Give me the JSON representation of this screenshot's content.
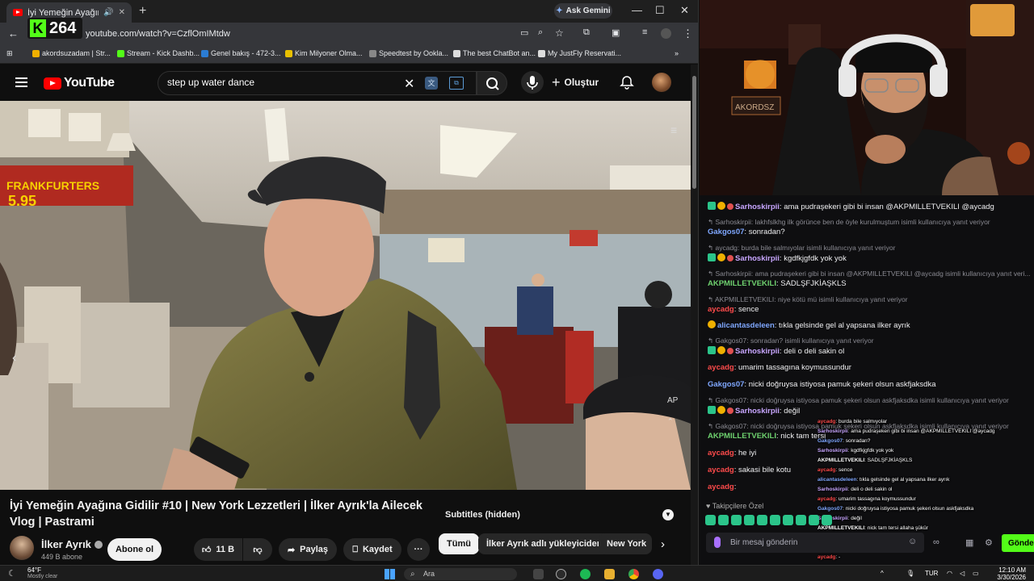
{
  "browser": {
    "tab_title": "İyi Yemeğin Ayağına Gidili",
    "ask_gemini": "Ask Gemini",
    "url": "youtube.com/watch?v=CzflOmIMtdw",
    "kick_viewers": "264",
    "bookmarks": [
      {
        "label": "akordsuzadam | Str...",
        "color": "#f0b000"
      },
      {
        "label": "Stream - Kick Dashb...",
        "color": "#53fc18"
      },
      {
        "label": "Genel bakış - 472-3...",
        "color": "#2b7cd3"
      },
      {
        "label": "Kim Milyoner Olma...",
        "color": "#e8c000"
      },
      {
        "label": "Speedtest by Ookla...",
        "color": "#888888"
      },
      {
        "label": "The best ChatBot an...",
        "color": "#dddddd"
      },
      {
        "label": "My JustFly Reservati...",
        "color": "#dddddd"
      }
    ]
  },
  "youtube": {
    "logo_text": "YouTube",
    "search_value": "step up water dance",
    "create_label": "Oluştur",
    "video_title": "İyi Yemeğin Ayağına Gidilir #10 | New York Lezzetleri | İlker Ayrık'la Ailecek Vlog | Pastrami",
    "channel_name": "İlker Ayrık",
    "channel_subs": "449 B abone",
    "subscribe_label": "Abone ol",
    "like_count": "11 B",
    "share_label": "Paylaş",
    "save_label": "Kaydet",
    "subtitles_label": "Subtitles (hidden)",
    "chips": [
      "Tümü",
      "İlker Ayrık adlı yükleyiciden",
      "New York"
    ],
    "video_overlay_text": "AP"
  },
  "chat": {
    "messages": [
      {
        "type": "msg",
        "user": "Sarhoskirpii",
        "ucls": "u-purple",
        "badges": "gyr",
        "text": ": ama pudraşekeri gibi bi insan @AKPMILLETVEKILI @aycadg"
      },
      {
        "type": "reply",
        "text": "Sarhoskirpii: lakhfslkhg ilk görünce ben de öyle kurulmuştum isimli kullanıcıya yanıt veriyor"
      },
      {
        "type": "msg",
        "user": "Gakgos07",
        "ucls": "u-blue",
        "badges": "",
        "text": ": sonradan?"
      },
      {
        "type": "reply",
        "text": "aycadg: burda bile salmıyolar isimli kullanıcıya yanıt veriyor"
      },
      {
        "type": "msg",
        "user": "Sarhoskirpii",
        "ucls": "u-purple",
        "badges": "gyr",
        "text": ": kgdfkjgfdk yok yok"
      },
      {
        "type": "reply",
        "text": "Sarhoskirpii: ama pudraşekeri gibi bi insan @AKPMILLETVEKILI @aycadg isimli kullanıcıya yanıt veri..."
      },
      {
        "type": "msg",
        "user": "AKPMILLETVEKILI",
        "ucls": "u-green",
        "badges": "",
        "text": ": SADLŞFJKİAŞKLS"
      },
      {
        "type": "reply",
        "text": "AKPMILLETVEKILI: niye kötü mü isimli kullanıcıya yanıt veriyor"
      },
      {
        "type": "msg",
        "user": "aycadg",
        "ucls": "u-red",
        "badges": "",
        "text": ": sence"
      },
      {
        "type": "msg",
        "user": "alicantasdeleen",
        "ucls": "u-blue",
        "badges": "y",
        "text": ": tıkla gelsinde gel al yapsana ilker ayrık"
      },
      {
        "type": "reply",
        "text": "Gakgos07: sonradan? isimli kullanıcıya yanıt veriyor"
      },
      {
        "type": "msg",
        "user": "Sarhoskirpii",
        "ucls": "u-purple",
        "badges": "gyr",
        "text": ": deli o deli sakin ol"
      },
      {
        "type": "msg",
        "user": "aycadg",
        "ucls": "u-red",
        "badges": "",
        "text": ": umarim tassagına koymussundur"
      },
      {
        "type": "msg",
        "user": "Gakgos07",
        "ucls": "u-blue",
        "badges": "",
        "text": ": nicki doğruysa istiyosa pamuk şekeri olsun askfjaksdka"
      },
      {
        "type": "reply",
        "text": "Gakgos07: nicki doğruysa istiyosa pamuk şekeri olsun askfjaksdka isimli kullanıcıya yanıt veriyor"
      },
      {
        "type": "msg",
        "user": "Sarhoskirpii",
        "ucls": "u-purple",
        "badges": "gyr",
        "text": ": değil"
      },
      {
        "type": "reply",
        "text": "Gakgos07: nicki doğruysa istiyosa pamuk şekeri olsun askfjaksdka isimli kullanıcıya yanıt veriyor"
      },
      {
        "type": "msg",
        "user": "AKPMILLETVEKILI",
        "ucls": "u-green",
        "badges": "",
        "text": ": nick tam tersi"
      },
      {
        "type": "msg",
        "user": "aycadg",
        "ucls": "u-red",
        "badges": "",
        "text": ": he iyi"
      },
      {
        "type": "msg",
        "user": "aycadg",
        "ucls": "u-red",
        "badges": "",
        "text": ": sakasi bile kotu"
      },
      {
        "type": "msg",
        "user": "aycadg",
        "ucls": "u-red",
        "badges": "",
        "text": ":"
      }
    ],
    "overlay": [
      {
        "user": "aycadg",
        "ucls": "u-red",
        "text": ": burda bile salmıyolar"
      },
      {
        "user": "Sarhoskirpii",
        "ucls": "u-purple",
        "text": ": ama pudraşekeri gibi bi insan @AKPMILLETVEKILI @aycadg"
      },
      {
        "user": "Gakgos07",
        "ucls": "u-blue",
        "text": ": sonradan?"
      },
      {
        "user": "Sarhoskirpii",
        "ucls": "u-purple",
        "text": ": kgdfkjgfdk yok yok"
      },
      {
        "user": "AKPMILLETVEKILI",
        "ucls": "u-white",
        "text": ": SADLŞFJKİAŞKLS"
      },
      {
        "user": "aycadg",
        "ucls": "u-red",
        "text": ": sence"
      },
      {
        "user": "alicantasdeleen",
        "ucls": "u-blue",
        "text": ": tıkla gelsinde gel al yapsana ilker ayrık"
      },
      {
        "user": "Sarhoskirpii",
        "ucls": "u-purple",
        "text": ": deli o deli sakin ol"
      },
      {
        "user": "aycadg",
        "ucls": "u-red",
        "text": ": umarim tassagına koymussundur"
      },
      {
        "user": "Gakgos07",
        "ucls": "u-blue",
        "text": ": nicki doğruysa istiyosa pamuk şekeri olsun askfjaksdka"
      },
      {
        "user": "Sarhoskirpii",
        "ucls": "u-purple",
        "text": ": değil"
      },
      {
        "user": "AKPMILLETVEKILI",
        "ucls": "u-white",
        "text": ": nick tam tersi allaha şükür"
      },
      {
        "user": "aycadg",
        "ucls": "u-red",
        "text": ": he iyi"
      },
      {
        "user": "aycadg",
        "ucls": "u-red",
        "text": ": sakasi bile kotu"
      },
      {
        "user": "aycadg",
        "ucls": "u-red",
        "text": ": -"
      }
    ],
    "followers_label": "Takipçilere Özel",
    "input_placeholder": "Bir mesaj gönderin",
    "send_label": "Gönder"
  },
  "taskbar": {
    "temp": "64°F",
    "weather": "Mostly clear",
    "search_label": "Ara",
    "lang": "TUR",
    "time": "12:10 AM",
    "date": "3/30/2026"
  },
  "webcam": {
    "sign_text": "AKORDSZ"
  }
}
